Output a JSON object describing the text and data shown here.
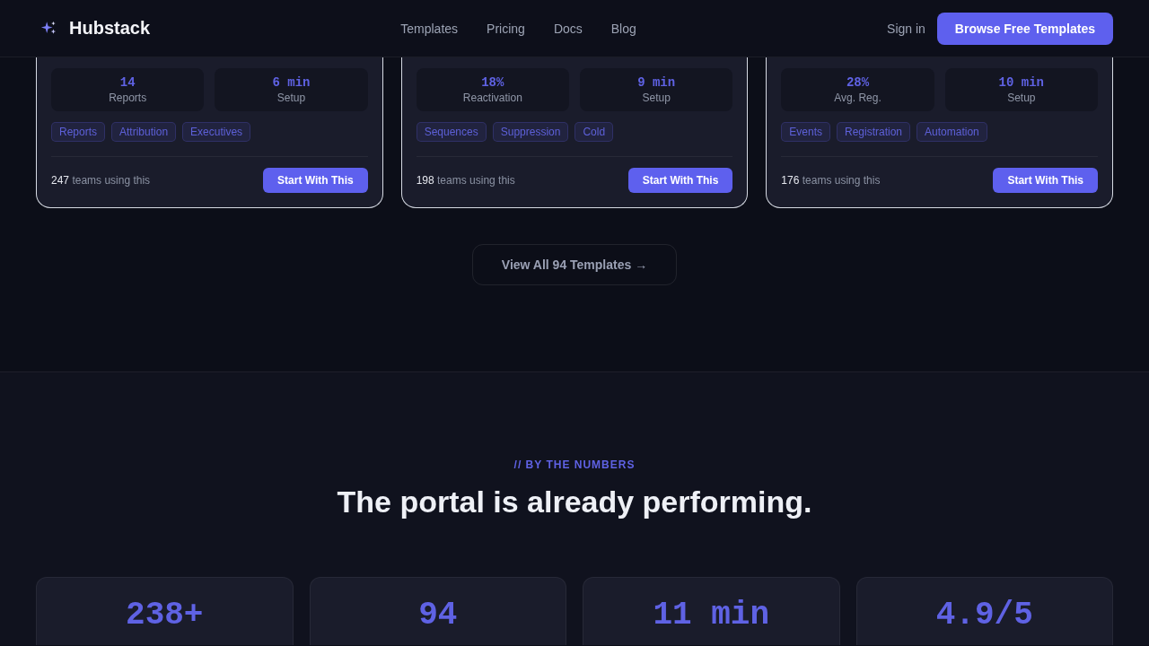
{
  "header": {
    "brand": "Hubstack",
    "nav": [
      "Templates",
      "Pricing",
      "Docs",
      "Blog"
    ],
    "sign_in": "Sign in",
    "cta": "Browse Free Templates"
  },
  "templates": [
    {
      "stats": [
        {
          "value": "14",
          "label": "Reports"
        },
        {
          "value": "6 min",
          "label": "Setup"
        }
      ],
      "tags": [
        "Reports",
        "Attribution",
        "Executives"
      ],
      "users_count": "247",
      "users_label": "teams using this",
      "button": "Start With This"
    },
    {
      "stats": [
        {
          "value": "18%",
          "label": "Reactivation"
        },
        {
          "value": "9 min",
          "label": "Setup"
        }
      ],
      "tags": [
        "Sequences",
        "Suppression",
        "Cold"
      ],
      "users_count": "198",
      "users_label": "teams using this",
      "button": "Start With This"
    },
    {
      "stats": [
        {
          "value": "28%",
          "label": "Avg. Reg."
        },
        {
          "value": "10 min",
          "label": "Setup"
        }
      ],
      "tags": [
        "Events",
        "Registration",
        "Automation"
      ],
      "users_count": "176",
      "users_label": "teams using this",
      "button": "Start With This"
    }
  ],
  "view_all": "View All 94 Templates →",
  "numbers": {
    "eyebrow": "// BY THE NUMBERS",
    "heading": "The portal is already performing.",
    "stats": [
      "238+",
      "94",
      "11 min",
      "4.9/5"
    ]
  }
}
